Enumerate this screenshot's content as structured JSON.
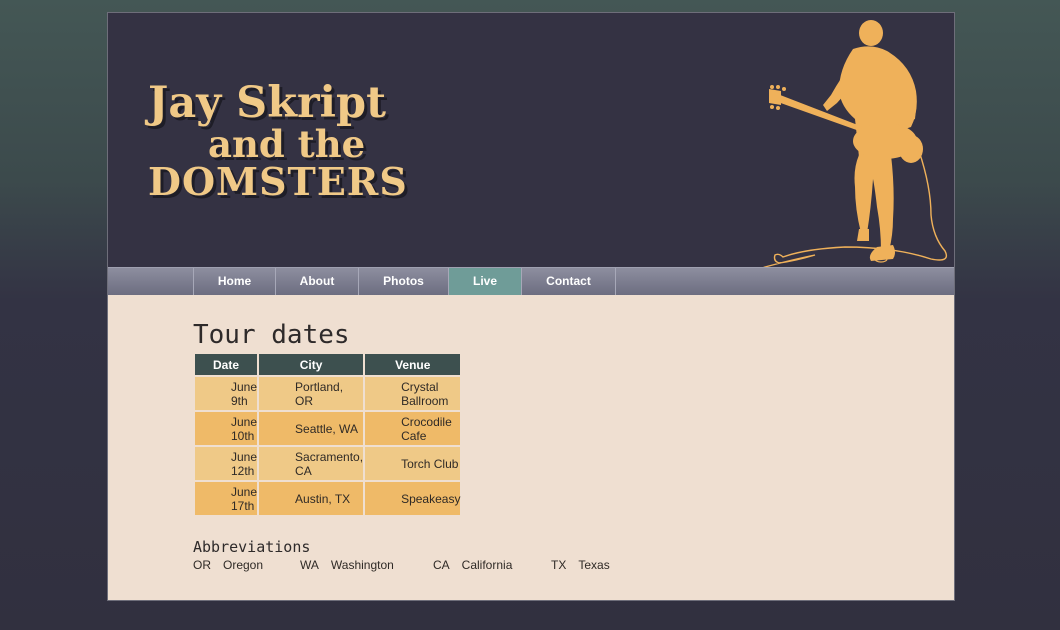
{
  "header": {
    "logo_line1": "Jay Skript",
    "logo_line2": "and the",
    "logo_line3": "DOMSTERS"
  },
  "nav": {
    "items": [
      {
        "label": "Home",
        "active": false
      },
      {
        "label": "About",
        "active": false
      },
      {
        "label": "Photos",
        "active": false
      },
      {
        "label": "Live",
        "active": true
      },
      {
        "label": "Contact",
        "active": false
      }
    ]
  },
  "main": {
    "heading": "Tour dates",
    "table": {
      "columns": [
        "Date",
        "City",
        "Venue"
      ],
      "rows": [
        [
          "June 9th",
          "Portland, OR",
          "Crystal Ballroom"
        ],
        [
          "June 10th",
          "Seattle, WA",
          "Crocodile Cafe"
        ],
        [
          "June 12th",
          "Sacramento, CA",
          "Torch Club"
        ],
        [
          "June 17th",
          "Austin, TX",
          "Speakeasy"
        ]
      ]
    },
    "abbreviations": {
      "title": "Abbreviations",
      "items": [
        {
          "code": "OR",
          "name": "Oregon"
        },
        {
          "code": "WA",
          "name": "Washington"
        },
        {
          "code": "CA",
          "name": "California"
        },
        {
          "code": "TX",
          "name": "Texas"
        }
      ]
    }
  },
  "colors": {
    "banner": "#343243",
    "logo": "#f0c987",
    "guitarist": "#efb15a",
    "nav_active": "#6f9c98",
    "table_header": "#3d504f",
    "row_light": "#efc987",
    "row_dark": "#efba68",
    "content_bg": "#efdfd1"
  }
}
